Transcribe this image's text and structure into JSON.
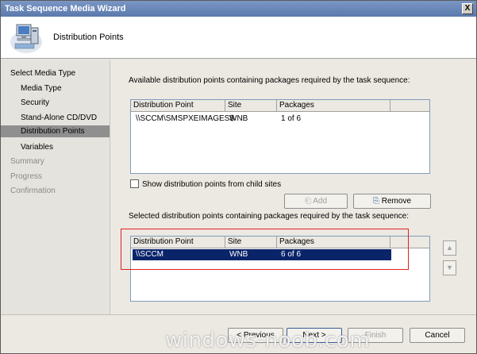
{
  "window": {
    "title": "Task Sequence Media Wizard",
    "close_glyph": "X"
  },
  "header": {
    "title": "Distribution Points",
    "icon": "computer-network-icon"
  },
  "sidebar": {
    "items": [
      {
        "label": "Select Media Type",
        "state": "normal"
      },
      {
        "label": "Media Type",
        "state": "normal"
      },
      {
        "label": "Security",
        "state": "normal"
      },
      {
        "label": "Stand-Alone CD/DVD",
        "state": "normal"
      },
      {
        "label": "Distribution Points",
        "state": "selected"
      },
      {
        "label": "Variables",
        "state": "normal"
      },
      {
        "label": "Summary",
        "state": "disabled"
      },
      {
        "label": "Progress",
        "state": "disabled"
      },
      {
        "label": "Confirmation",
        "state": "disabled"
      }
    ]
  },
  "main": {
    "available_label": "Available distribution points containing packages required by the task sequence:",
    "available_list": {
      "columns": [
        "Distribution Point",
        "Site",
        "Packages"
      ],
      "rows": [
        {
          "dp": "\\\\SCCM\\SMSPXEIMAGES$",
          "site": "WNB",
          "packages": "1 of 6"
        }
      ]
    },
    "show_child_label": "Show distribution points from child sites",
    "show_child_checked": false,
    "add_label": "Add",
    "remove_label": "Remove",
    "selected_label": "Selected distribution points containing packages required by the task sequence:",
    "selected_list": {
      "columns": [
        "Distribution Point",
        "Site",
        "Packages"
      ],
      "rows": [
        {
          "dp": "\\\\SCCM",
          "site": "WNB",
          "packages": "6 of 6"
        }
      ]
    }
  },
  "footer": {
    "previous_label": "< Previous",
    "next_label": "Next >",
    "finish_label": "Finish",
    "cancel_label": "Cancel"
  },
  "watermark": "windows-noob.com",
  "colors": {
    "accent": "#0a246a",
    "highlight_box": "#e02020"
  }
}
